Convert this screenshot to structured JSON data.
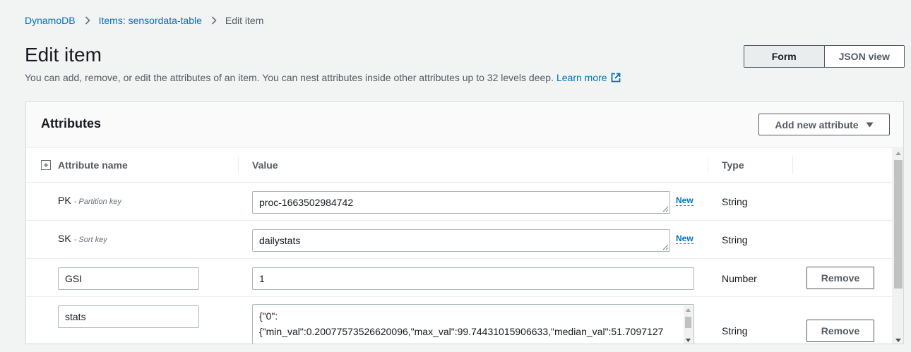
{
  "breadcrumb": {
    "items": [
      "DynamoDB",
      "Items: sensordata-table"
    ],
    "current": "Edit item"
  },
  "header": {
    "title": "Edit item",
    "description": "You can add, remove, or edit the attributes of an item. You can nest attributes inside other attributes up to 32 levels deep.",
    "learn_more": "Learn more"
  },
  "view_toggle": {
    "options": [
      "Form",
      "JSON view"
    ],
    "selected": "Form"
  },
  "attributes": {
    "title": "Attributes",
    "add_button": "Add new attribute",
    "columns": [
      "Attribute name",
      "Value",
      "Type"
    ],
    "rows": [
      {
        "name": "PK",
        "key_type": "- Partition key",
        "value": "proc-1663502984742",
        "badge": "New",
        "type": "String"
      },
      {
        "name": "SK",
        "key_type": "- Sort key",
        "value": "dailystats",
        "badge": "New",
        "type": "String"
      },
      {
        "name": "GSI",
        "value": "1",
        "type": "Number",
        "action": "Remove"
      },
      {
        "name": "stats",
        "value_lines": [
          "{\"0\":",
          "{\"min_val\":0.20077573526620096,\"max_val\":99.74431015906633,\"median_val\":51.7097127"
        ],
        "type": "String",
        "action": "Remove"
      }
    ]
  },
  "colors": {
    "link": "#0073bb",
    "text": "#16191f",
    "muted": "#545b64",
    "border": "#aab7b8",
    "page_bg": "#f2f3f3"
  }
}
